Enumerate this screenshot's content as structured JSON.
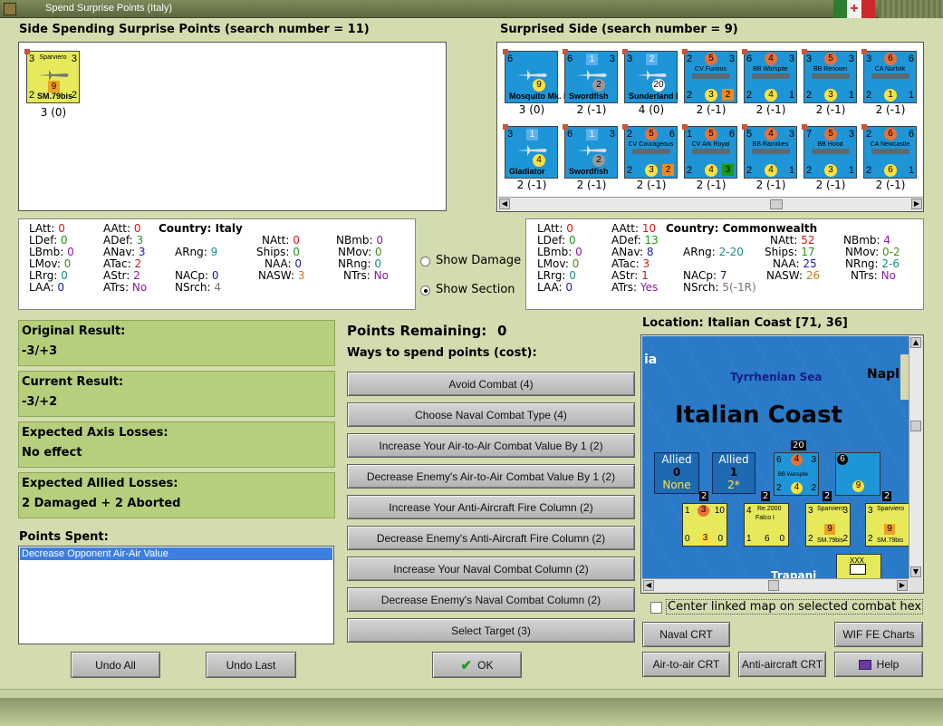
{
  "window": {
    "title": "Spend Surprise Points (Italy)"
  },
  "left_side": {
    "header": "Side Spending Surprise Points (search number = 11)",
    "units": [
      {
        "name": "Sparviero",
        "type": "SM.79bis",
        "tl": "3",
        "tr": "3",
        "mid": "9",
        "bl": "2",
        "br": "2",
        "caption": "3 (0)"
      }
    ]
  },
  "right_side": {
    "header": "Surprised Side (search number = 9)",
    "units_row1": [
      {
        "name": "Mosquito Mk. II",
        "tl": "6",
        "mid": "9",
        "caption": "3 (0)",
        "kind": "plane"
      },
      {
        "name": "Swordfish",
        "tl": "6",
        "box": "1",
        "tr": "3",
        "mid": "2",
        "caption": "2 (-1)",
        "kind": "plane"
      },
      {
        "name": "Sunderland I",
        "tl": "3",
        "box": "2",
        "mid": "20",
        "caption": "4 (0)",
        "kind": "plane"
      },
      {
        "name": "CV Furious",
        "tl": "2",
        "dot": "5",
        "tr": "3",
        "mid": "3",
        "br": "2",
        "caption": "2 (-1)",
        "kind": "ship"
      },
      {
        "name": "BB Warspite",
        "tl": "6",
        "dot": "4",
        "tr": "3",
        "mid": "4",
        "caption": "2 (-1)",
        "kind": "ship"
      },
      {
        "name": "BB Renown",
        "tl": "3",
        "dot": "5",
        "tr": "3",
        "mid": "3",
        "caption": "2 (-1)",
        "kind": "ship"
      },
      {
        "name": "CA Norfolk",
        "tl": "3",
        "dot": "6",
        "tr": "6",
        "mid": "1",
        "caption": "2 (-1)",
        "kind": "ship"
      }
    ],
    "units_row2": [
      {
        "name": "Gladiator",
        "tl": "3",
        "box": "1",
        "mid": "4",
        "caption": "2 (-1)",
        "kind": "plane"
      },
      {
        "name": "Swordfish",
        "tl": "6",
        "box": "1",
        "tr": "3",
        "mid": "2",
        "caption": "2 (-1)",
        "kind": "plane"
      },
      {
        "name": "CV Courageous",
        "tl": "2",
        "dot": "5",
        "tr": "6",
        "mid": "3",
        "br": "2",
        "caption": "2 (-1)",
        "kind": "ship"
      },
      {
        "name": "CV Ark Royal",
        "tl": "1",
        "dot": "5",
        "tr": "6",
        "mid": "4",
        "br": "3",
        "caption": "2 (-1)",
        "kind": "ship"
      },
      {
        "name": "BB Ramillies",
        "tl": "5",
        "dot": "4",
        "tr": "3",
        "mid": "4",
        "caption": "2 (-1)",
        "kind": "ship"
      },
      {
        "name": "BB Hood",
        "tl": "7",
        "dot": "5",
        "tr": "3",
        "mid": "3",
        "caption": "2 (-1)",
        "kind": "ship"
      },
      {
        "name": "CA Newcastle",
        "tl": "2",
        "dot": "6",
        "tr": "6",
        "mid": "6",
        "caption": "2 (-1)",
        "kind": "ship"
      }
    ]
  },
  "stats_left": {
    "country_label": "Country:",
    "country": "Italy",
    "LAtt": "0",
    "LDef": "0",
    "LBmb": "0",
    "LMov": "0",
    "LRrg": "0",
    "LAA": "0",
    "AAtt": "0",
    "ADef": "3",
    "ANav": "3",
    "ATac": "2",
    "AStr": "2",
    "ATrs": "No",
    "ARng": "9",
    "NACp": "0",
    "NSrch": "4",
    "NAtt": "0",
    "Ships": "0",
    "NAA": "0",
    "NASW": "3",
    "NBmb": "0",
    "NMov": "0",
    "NRng": "0",
    "NTrs": "No"
  },
  "stats_right": {
    "country_label": "Country:",
    "country": "Commonwealth",
    "LAtt": "0",
    "LDef": "0",
    "LBmb": "0",
    "LMov": "0",
    "LRrg": "0",
    "LAA": "0",
    "AAtt": "10",
    "ADef": "13",
    "ANav": "8",
    "ATac": "3",
    "AStr": "1",
    "ATrs": "Yes",
    "ARng": "2-20",
    "NACp": "7",
    "NSrch": "5(-1R)",
    "NAtt": "52",
    "Ships": "17",
    "NAA": "25",
    "NASW": "26",
    "NBmb": "4",
    "NMov": "0-2",
    "NRng": "2-6",
    "NTrs": "No"
  },
  "show_options": {
    "damage": "Show Damage",
    "section": "Show Section"
  },
  "results": {
    "original_label": "Original Result:",
    "original_value": "-3/+3",
    "current_label": "Current Result:",
    "current_value": "-3/+2",
    "axis_label": "Expected Axis Losses:",
    "axis_value": "No effect",
    "allied_label": "Expected Allied Losses:",
    "allied_value": "2 Damaged + 2 Aborted"
  },
  "points_spent": {
    "label": "Points Spent:",
    "items": [
      "Decrease Opponent Air-Air Value"
    ]
  },
  "points": {
    "remaining_label": "Points Remaining:",
    "remaining_value": "0",
    "ways_label": "Ways to spend points (cost):",
    "options": [
      "Avoid Combat (4)",
      "Choose Naval Combat Type (4)",
      "Increase Your Air-to-Air Combat Value By 1 (2)",
      "Decrease Enemy's Air-to-Air Combat Value By 1 (2)",
      "Increase Your Anti-Aircraft Fire Column (2)",
      "Decrease Enemy's Anti-Aircraft Fire Column (2)",
      "Increase Your Naval Combat Column (2)",
      "Decrease Enemy's Naval Combat Column (2)",
      "Select Target (3)"
    ]
  },
  "location": {
    "label": "Location: Italian Coast [71, 36]",
    "map_title": "Italian Coast",
    "sea_label": "Tyrrhenian Sea",
    "left_edge": "ia",
    "napl": "Napl",
    "trapani": "Trapani",
    "allied_box1": {
      "title": "Allied",
      "num": "0",
      "sub": "None"
    },
    "allied_box2": {
      "title": "Allied",
      "num": "1",
      "sub": "2*"
    },
    "stack_counts": [
      "20",
      "2",
      "2",
      "2",
      "2"
    ],
    "center_linked": "Center linked map on selected combat hex"
  },
  "buttons": {
    "undo_all": "Undo All",
    "undo_last": "Undo Last",
    "ok": "OK",
    "naval_crt": "Naval CRT",
    "wif_charts": "WIF FE Charts",
    "air_crt": "Air-to-air CRT",
    "aa_crt": "Anti-aircraft CRT",
    "help": "Help"
  }
}
